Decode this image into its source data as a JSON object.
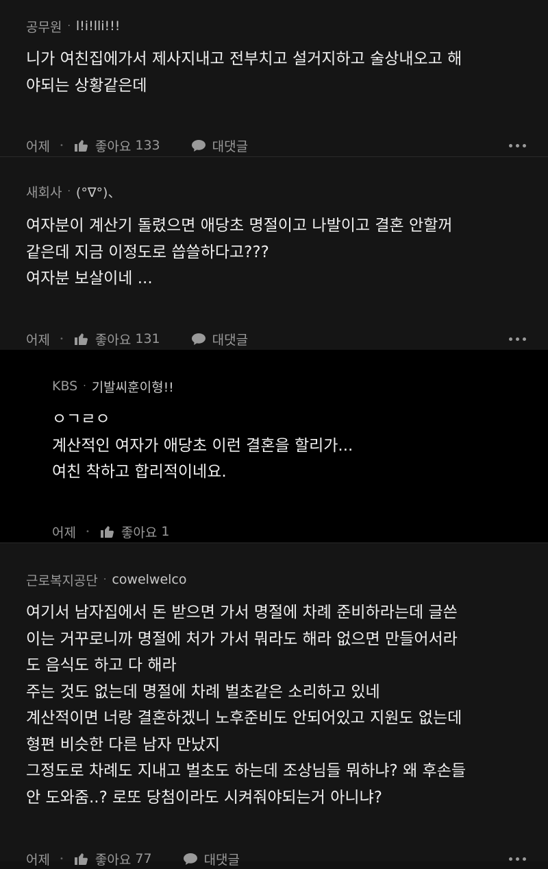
{
  "comments": [
    {
      "org": "공무원",
      "nick": "l!i!lli!!!",
      "lines": [
        "니가 여친집에가서 제사지내고 전부치고 설거지하고 술상내오고 해",
        "야되는 상황같은데"
      ],
      "time": "어제",
      "like_label": "좋아요",
      "likes": "133",
      "reply_label": "대댓글"
    },
    {
      "org": "새회사",
      "nick": "(°∇°)、",
      "lines": [
        "여자분이 계산기 돌렸으면 애당초 명절이고 나발이고 결혼 안할꺼",
        "같은데 지금 이정도로 씁쓸하다고???",
        "여자분 보살이네 ..."
      ],
      "time": "어제",
      "like_label": "좋아요",
      "likes": "131",
      "reply_label": "대댓글"
    }
  ],
  "reply": {
    "org": "KBS",
    "nick": "기발씨훈이형!!",
    "lines": [
      "ㅇㄱㄹㅇ",
      "계산적인 여자가 애당초 이런 결혼을 할리가...",
      "여친 착하고 합리적이네요."
    ],
    "time": "어제",
    "like_label": "좋아요",
    "likes": "1"
  },
  "last": {
    "org": "근로복지공단",
    "nick": "cowelwelco",
    "lines": [
      "여기서 남자집에서 돈 받으면 가서 명절에 차례 준비하라는데 글쓴",
      "이는 거꾸로니까 명절에 처가 가서 뭐라도 해라 없으면 만들어서라",
      "도 음식도 하고 다 해라",
      "주는 것도 없는데 명절에 차례 벌초같은 소리하고 있네",
      "계산적이면 너랑 결혼하겠니 노후준비도 안되어있고 지원도 없는데",
      "형편 비슷한 다른 남자 만났지",
      "그정도로 차례도 지내고 벌초도 하는데 조상님들 뭐하냐? 왜 후손들",
      "안 도와줌..? 로또 당첨이라도 시켜줘야되는거 아니냐?"
    ],
    "time": "어제",
    "like_label": "좋아요",
    "likes": "77",
    "reply_label": "대댓글"
  }
}
